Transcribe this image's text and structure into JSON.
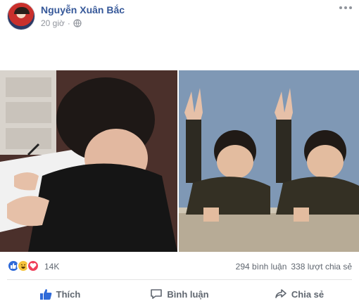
{
  "post": {
    "author": "Nguyễn Xuân Bắc",
    "time": "20 giờ",
    "privacy_icon": "globe-icon"
  },
  "reactions": {
    "icons": [
      "like-icon",
      "haha-icon",
      "love-icon"
    ],
    "count": "14K",
    "comments": "294 bình luận",
    "shares": "338 lượt chia sẻ"
  },
  "actions": {
    "like_label": "Thích",
    "comment_label": "Bình luận",
    "share_label": "Chia sẻ"
  },
  "colors": {
    "name": "#365899",
    "meta": "#90949c",
    "action": "#606770",
    "like_blue": "#2f6ad8"
  }
}
